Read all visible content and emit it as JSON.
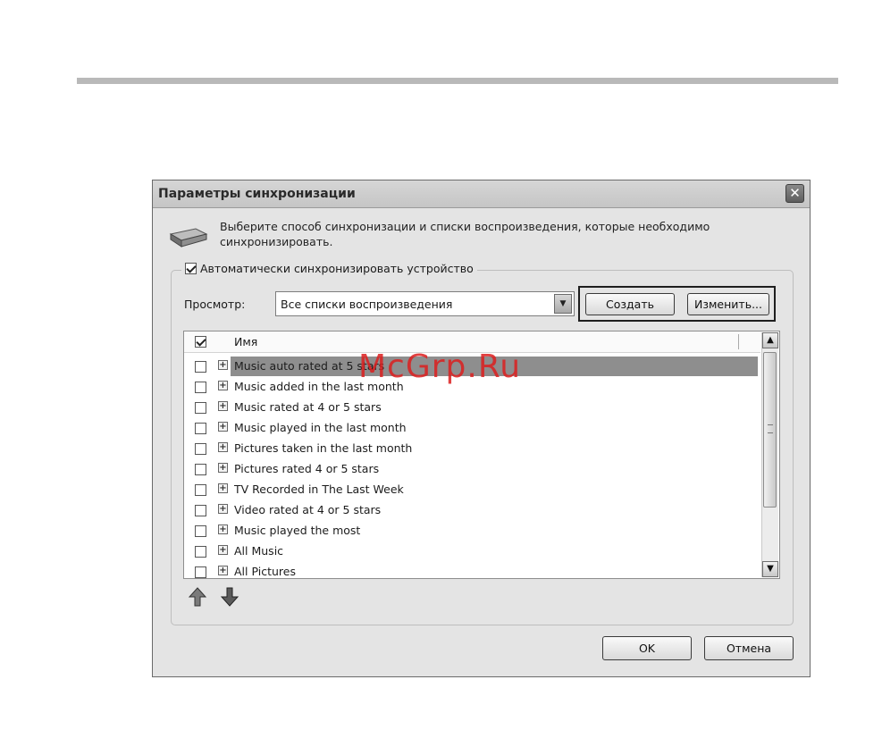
{
  "dialog": {
    "title": "Параметры синхронизации",
    "close_symbol": "✕",
    "intro_text": "Выберите способ синхронизации и списки воспроизведения, которые необходимо синхронизировать.",
    "auto_sync_label": "Автоматически синхронизировать устройство",
    "auto_sync_checked": true,
    "view_label": "Просмотр:",
    "view_value": "Все списки воспроизведения",
    "create_button": "Создать",
    "change_button": "Изменить...",
    "ok_button": "OK",
    "cancel_button": "Отмена"
  },
  "list": {
    "header_name": "Имя",
    "header_checked": true,
    "items": [
      {
        "label": "Music auto rated at 5 stars",
        "checked": false,
        "selected": true
      },
      {
        "label": "Music added in the last month",
        "checked": false,
        "selected": false
      },
      {
        "label": "Music rated at 4 or 5 stars",
        "checked": false,
        "selected": false
      },
      {
        "label": "Music played in the last month",
        "checked": false,
        "selected": false
      },
      {
        "label": "Pictures taken in the last month",
        "checked": false,
        "selected": false
      },
      {
        "label": "Pictures rated 4 or 5 stars",
        "checked": false,
        "selected": false
      },
      {
        "label": "TV Recorded in The Last Week",
        "checked": false,
        "selected": false
      },
      {
        "label": "Video rated at 4 or 5 stars",
        "checked": false,
        "selected": false
      },
      {
        "label": "Music played the most",
        "checked": false,
        "selected": false
      },
      {
        "label": "All Music",
        "checked": false,
        "selected": false
      },
      {
        "label": "All Pictures",
        "checked": false,
        "selected": false
      }
    ]
  },
  "watermark": "McGrp.Ru"
}
